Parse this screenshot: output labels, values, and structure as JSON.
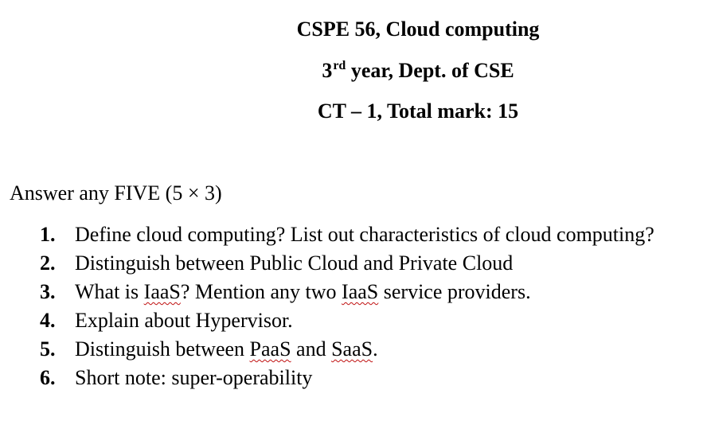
{
  "header": {
    "course": "CSPE 56, Cloud computing",
    "year_num": "3",
    "year_sup": "rd",
    "year_rest": "year, Dept. of CSE",
    "test": "CT – 1, Total mark: 15"
  },
  "instruction": "Answer any FIVE (5 × 3)",
  "questions": [
    {
      "num": "1.",
      "text": "Define cloud computing? List out characteristics of cloud computing?"
    },
    {
      "num": "2.",
      "text": "Distinguish between Public Cloud and Private Cloud"
    },
    {
      "num": "3.",
      "p1": "What is ",
      "t1": "IaaS",
      "p2": "? Mention any two ",
      "t2": "IaaS",
      "p3": " service providers."
    },
    {
      "num": "4.",
      "text": "Explain about Hypervisor."
    },
    {
      "num": "5.",
      "p1": "Distinguish between ",
      "t1": "PaaS",
      "p2": " and ",
      "t2": "SaaS",
      "p3": "."
    },
    {
      "num": "6.",
      "text": "Short note: super-operability"
    }
  ]
}
